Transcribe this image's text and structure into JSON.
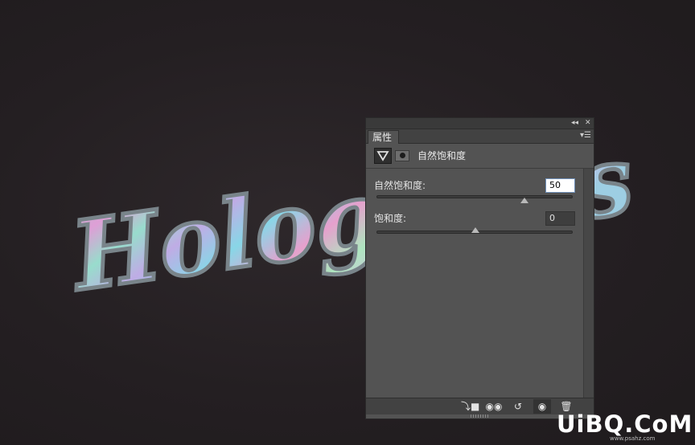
{
  "canvas": {
    "artwork_text": "Holograms",
    "background_color": "#241f22"
  },
  "panel": {
    "tab_label": "属性",
    "adjustment_title": "自然饱和度",
    "fields": [
      {
        "label": "自然饱和度:",
        "value": "50",
        "slider_percent": 75
      },
      {
        "label": "饱和度:",
        "value": "0",
        "slider_percent": 50
      }
    ],
    "icons": {
      "collapse": "double-chevron-left-icon",
      "close": "close-icon",
      "menu": "panel-menu-icon",
      "adjustment": "vibrance-triangle-icon",
      "mask": "layer-mask-icon"
    },
    "footer_icons": [
      "clip-to-layer-icon",
      "view-previous-state-icon",
      "reset-icon",
      "visibility-eye-icon",
      "trash-icon"
    ]
  },
  "watermark": {
    "main": "UiBQ.CoM",
    "sub": "www.psahz.com"
  }
}
